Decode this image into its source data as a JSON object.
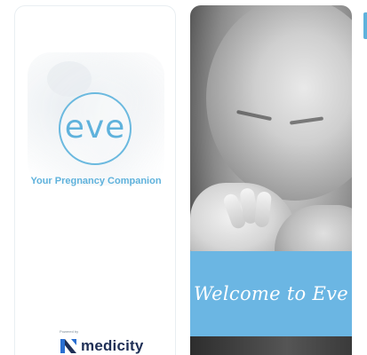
{
  "splash": {
    "logo_text": "eve",
    "tagline": "Your Pregnancy Companion",
    "powered_by": "Powered by",
    "brand_name": "medicity"
  },
  "welcome": {
    "headline": "Welcome to Eve"
  },
  "colors": {
    "accent": "#5fb2dc",
    "welcome_band": "#6bb6e3",
    "brand_navy": "#1f2f56"
  }
}
